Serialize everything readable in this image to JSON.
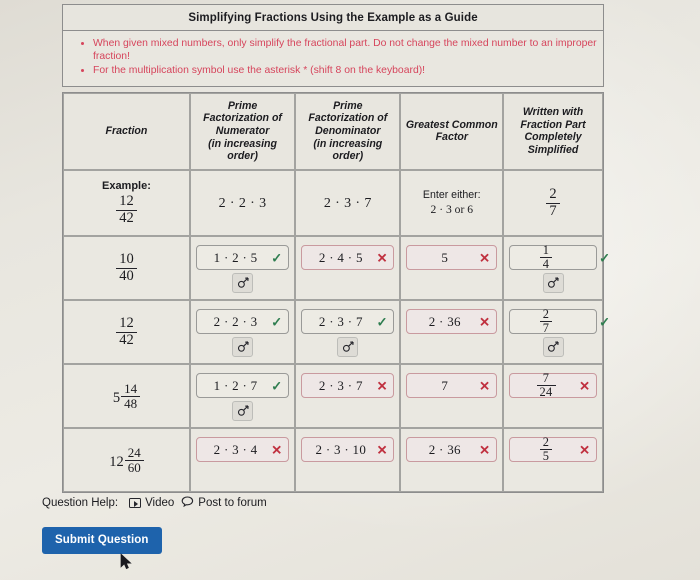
{
  "problem": {
    "title": "Simplifying Fractions Using the Example as a Guide",
    "notes": [
      "When given mixed numbers, only simplify the fractional part.  Do not change the mixed number to an improper fraction!",
      "For the multiplication symbol use the asterisk * (shift 8 on the keyboard)!"
    ]
  },
  "table": {
    "headers": [
      "Fraction",
      "Prime Factorization of Numerator (in increasing order)",
      "Prime Factorization of Denominator (in increasing order)",
      "Greatest Common Factor",
      "Written with Fraction Part Completely Simplified"
    ],
    "header_lines": {
      "h0": [
        "Fraction"
      ],
      "h1": [
        "Prime",
        "Factorization of",
        "Numerator",
        "(in increasing",
        "order)"
      ],
      "h2": [
        "Prime",
        "Factorization of",
        "Denominator",
        "(in increasing",
        "order)"
      ],
      "h3": [
        "Greatest Common",
        "Factor"
      ],
      "h4": [
        "Written with",
        "Fraction Part",
        "Completely",
        "Simplified"
      ]
    },
    "example": {
      "label": "Example:",
      "fraction": {
        "whole": "",
        "num": "12",
        "den": "42"
      },
      "numerator_factorization": "2 · 2 · 3",
      "denominator_factorization": "2 · 3 · 7",
      "gcf_hint_line1": "Enter either:",
      "gcf_hint_line2": "2 · 3 or 6",
      "simplified": {
        "whole": "",
        "num": "2",
        "den": "7"
      }
    },
    "rows": [
      {
        "fraction": {
          "whole": "",
          "num": "10",
          "den": "40"
        },
        "numerator": {
          "value": "1 · 2 · 5",
          "status": "correct",
          "has_preview": true
        },
        "denominator": {
          "value": "2 · 4 · 5",
          "status": "incorrect",
          "has_preview": false
        },
        "gcf": {
          "value": "5",
          "status": "incorrect",
          "has_preview": false
        },
        "simplified": {
          "whole": "",
          "num": "1",
          "den": "4",
          "status": "correct",
          "has_preview": true
        }
      },
      {
        "fraction": {
          "whole": "",
          "num": "12",
          "den": "42"
        },
        "numerator": {
          "value": "2 · 2 · 3",
          "status": "correct",
          "has_preview": true
        },
        "denominator": {
          "value": "2 · 3 · 7",
          "status": "correct",
          "has_preview": true
        },
        "gcf": {
          "value": "2 · 36",
          "status": "incorrect",
          "has_preview": false
        },
        "simplified": {
          "whole": "",
          "num": "2",
          "den": "7",
          "status": "correct",
          "has_preview": true
        }
      },
      {
        "fraction": {
          "whole": "5",
          "num": "14",
          "den": "48"
        },
        "numerator": {
          "value": "1 · 2 · 7",
          "status": "correct",
          "has_preview": true
        },
        "denominator": {
          "value": "2 · 3 · 7",
          "status": "incorrect",
          "has_preview": false
        },
        "gcf": {
          "value": "7",
          "status": "incorrect",
          "has_preview": false
        },
        "simplified": {
          "whole": "",
          "num": "7",
          "den": "24",
          "status": "incorrect",
          "has_preview": false
        }
      },
      {
        "fraction": {
          "whole": "12",
          "num": "24",
          "den": "60"
        },
        "numerator": {
          "value": "2 · 3 · 4",
          "status": "incorrect",
          "has_preview": false
        },
        "denominator": {
          "value": "2 · 3 · 10",
          "status": "incorrect",
          "has_preview": false
        },
        "gcf": {
          "value": "2 · 36",
          "status": "incorrect",
          "has_preview": false
        },
        "simplified": {
          "whole": "",
          "num": "2",
          "den": "5",
          "status": "incorrect",
          "has_preview": false
        }
      }
    ]
  },
  "footer": {
    "help_label": "Question Help:",
    "video_label": "Video",
    "forum_label": "Post to forum",
    "submit_label": "Submit Question"
  },
  "marks": {
    "correct": "✓",
    "incorrect": "✕"
  },
  "colors": {
    "note_text": "#d6455c",
    "correct": "#2e7d4f",
    "incorrect": "#c0303f",
    "submit_bg": "#1e63ac",
    "page_bg": "#e9e7e1"
  }
}
